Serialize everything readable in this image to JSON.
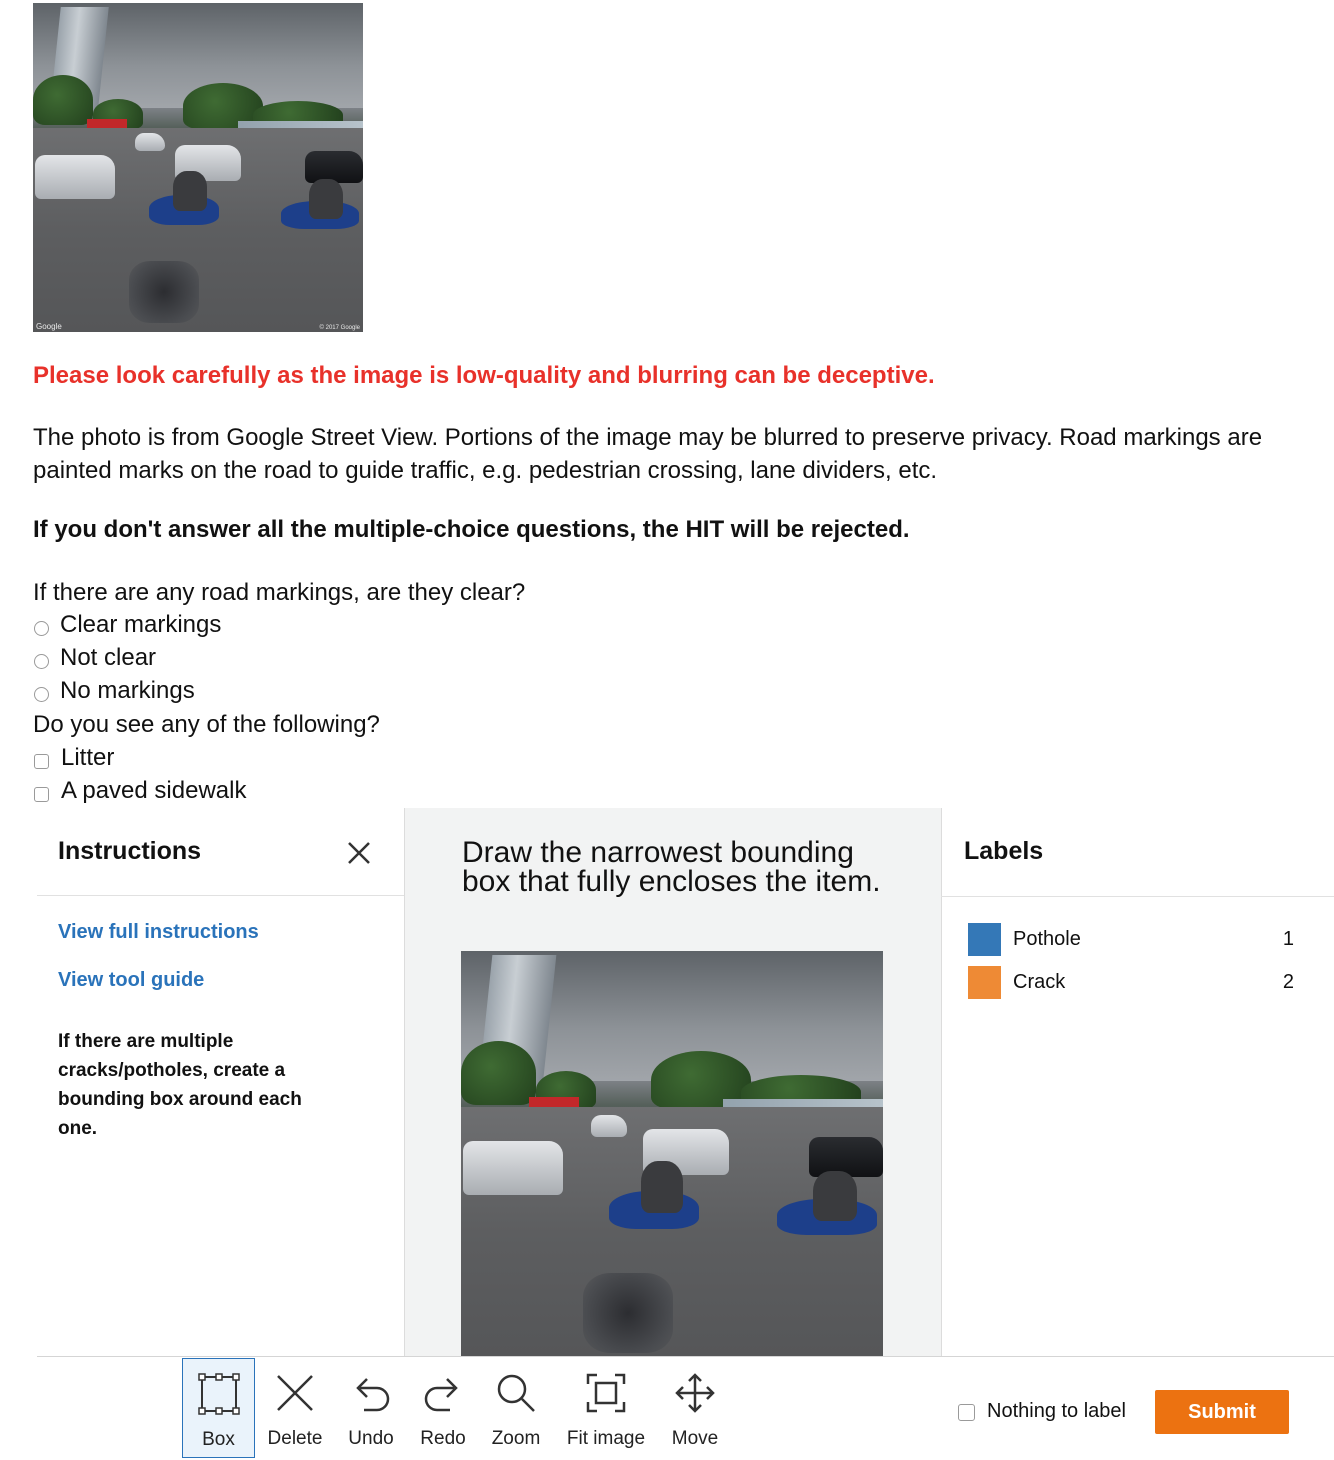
{
  "photo": {
    "watermark_left": "Google",
    "watermark_right": "© 2017 Google"
  },
  "warning": "Please look carefully as the image is low-quality and blurring can be deceptive.",
  "description": "The photo is from Google Street View. Portions of the image may be blurred to preserve privacy. Road markings are painted marks on the road to guide traffic, e.g. pedestrian crossing, lane dividers, etc.",
  "rejection_notice": "If you don't answer all the multiple-choice questions, the HIT will be rejected.",
  "question1": {
    "text": "If there are any road markings, are they clear?",
    "options": [
      "Clear markings",
      "Not clear",
      "No markings"
    ]
  },
  "question2": {
    "text": "Do you see any of the following?",
    "options": [
      "Litter",
      "A paved sidewalk"
    ]
  },
  "instructions": {
    "title": "Instructions",
    "full_link": "View full instructions",
    "tool_link": "View tool guide",
    "text": "If there are multiple cracks/potholes, create a bounding box around each one."
  },
  "task": {
    "prompt": "Draw the narrowest bounding box that fully encloses the item."
  },
  "labels": {
    "title": "Labels",
    "items": [
      {
        "name": "Pothole",
        "hotkey": "1",
        "color": "#3478b7"
      },
      {
        "name": "Crack",
        "hotkey": "2",
        "color": "#ee8a35"
      }
    ]
  },
  "toolbar": {
    "tools": [
      {
        "label": "Box",
        "icon": "box-icon",
        "active": true
      },
      {
        "label": "Delete",
        "icon": "close-icon"
      },
      {
        "label": "Undo",
        "icon": "undo-icon"
      },
      {
        "label": "Redo",
        "icon": "redo-icon"
      },
      {
        "label": "Zoom",
        "icon": "zoom-icon"
      },
      {
        "label": "Fit image",
        "icon": "fit-image-icon"
      },
      {
        "label": "Move",
        "icon": "move-icon"
      }
    ],
    "nothing_to_label": "Nothing to label",
    "submit": "Submit"
  },
  "colors": {
    "warning": "#e8312a",
    "link": "#2a73ba",
    "submit": "#ec7211"
  }
}
